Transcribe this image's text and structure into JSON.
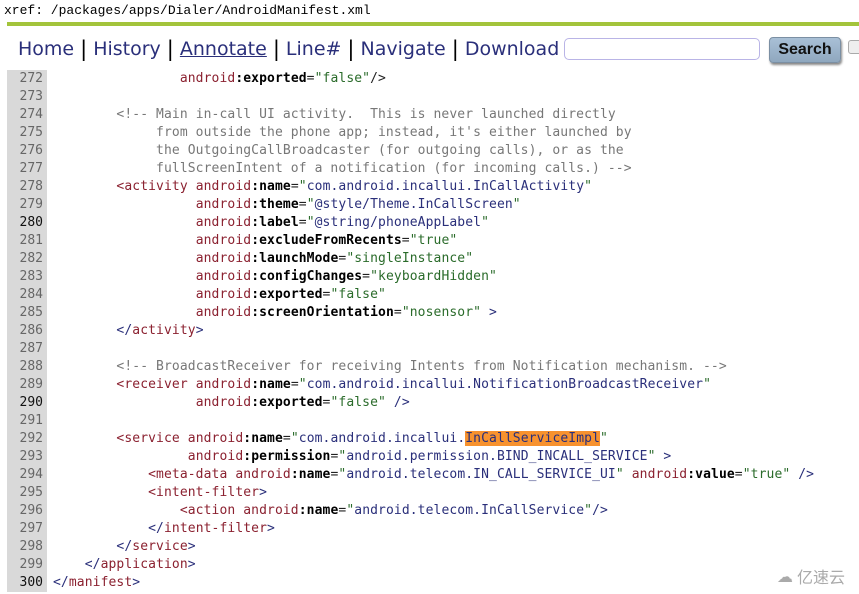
{
  "xref": "xref: /packages/apps/Dialer/AndroidManifest.xml",
  "nav": {
    "items": [
      {
        "label": "Home",
        "active": false
      },
      {
        "label": "History",
        "active": false
      },
      {
        "label": "Annotate",
        "active": true
      },
      {
        "label": "Line#",
        "active": false
      },
      {
        "label": "Navigate",
        "active": false
      },
      {
        "label": "Download",
        "active": false
      }
    ],
    "separator": "|"
  },
  "search": {
    "value": "",
    "placeholder": "",
    "button_label": "Search"
  },
  "colors": {
    "accent_bar": "#a3c43b",
    "highlight": "#f7922e",
    "link": "#2a2f7a"
  },
  "lines": [
    {
      "n": "272",
      "dark": false,
      "segments": [
        [
          "",
          "                "
        ],
        [
          "an",
          "android"
        ],
        [
          "at",
          ":exported"
        ],
        [
          "",
          "="
        ],
        [
          "v",
          "\"false\""
        ],
        [
          "",
          "/>"
        ]
      ]
    },
    {
      "n": "273",
      "dark": false,
      "segments": []
    },
    {
      "n": "274",
      "dark": false,
      "segments": [
        [
          "",
          "        "
        ],
        [
          "c",
          "<!-- Main in-call UI activity.  This is never launched directly"
        ]
      ]
    },
    {
      "n": "275",
      "dark": false,
      "segments": [
        [
          "",
          "             "
        ],
        [
          "c",
          "from outside the phone app; instead, it's either launched by"
        ]
      ]
    },
    {
      "n": "276",
      "dark": false,
      "segments": [
        [
          "",
          "             "
        ],
        [
          "c",
          "the OutgoingCallBroadcaster (for outgoing calls), or as the"
        ]
      ]
    },
    {
      "n": "277",
      "dark": false,
      "segments": [
        [
          "",
          "             "
        ],
        [
          "c",
          "fullScreenIntent of a notification (for incoming calls.) -->"
        ]
      ]
    },
    {
      "n": "278",
      "dark": false,
      "segments": [
        [
          "",
          "        "
        ],
        [
          "t",
          "<activity "
        ],
        [
          "an",
          "android"
        ],
        [
          "at",
          ":name"
        ],
        [
          "",
          "="
        ],
        [
          "v",
          "\""
        ],
        [
          "s",
          "com.android.incallui.InCallActivity"
        ],
        [
          "v",
          "\""
        ]
      ]
    },
    {
      "n": "279",
      "dark": false,
      "segments": [
        [
          "",
          "                  "
        ],
        [
          "an",
          "android"
        ],
        [
          "at",
          ":theme"
        ],
        [
          "",
          "="
        ],
        [
          "v",
          "\""
        ],
        [
          "s",
          "@style/Theme.InCallScreen"
        ],
        [
          "v",
          "\""
        ]
      ]
    },
    {
      "n": "280",
      "dark": true,
      "segments": [
        [
          "",
          "                  "
        ],
        [
          "an",
          "android"
        ],
        [
          "at",
          ":label"
        ],
        [
          "",
          "="
        ],
        [
          "v",
          "\""
        ],
        [
          "s",
          "@string/phoneAppLabel"
        ],
        [
          "v",
          "\""
        ]
      ]
    },
    {
      "n": "281",
      "dark": false,
      "segments": [
        [
          "",
          "                  "
        ],
        [
          "an",
          "android"
        ],
        [
          "at",
          ":excludeFromRecents"
        ],
        [
          "",
          "="
        ],
        [
          "v",
          "\"true\""
        ]
      ]
    },
    {
      "n": "282",
      "dark": false,
      "segments": [
        [
          "",
          "                  "
        ],
        [
          "an",
          "android"
        ],
        [
          "at",
          ":launchMode"
        ],
        [
          "",
          "="
        ],
        [
          "v",
          "\"singleInstance\""
        ]
      ]
    },
    {
      "n": "283",
      "dark": false,
      "segments": [
        [
          "",
          "                  "
        ],
        [
          "an",
          "android"
        ],
        [
          "at",
          ":configChanges"
        ],
        [
          "",
          "="
        ],
        [
          "v",
          "\"keyboardHidden\""
        ]
      ]
    },
    {
      "n": "284",
      "dark": false,
      "segments": [
        [
          "",
          "                  "
        ],
        [
          "an",
          "android"
        ],
        [
          "at",
          ":exported"
        ],
        [
          "",
          "="
        ],
        [
          "v",
          "\"false\""
        ]
      ]
    },
    {
      "n": "285",
      "dark": false,
      "segments": [
        [
          "",
          "                  "
        ],
        [
          "an",
          "android"
        ],
        [
          "at",
          ":screenOrientation"
        ],
        [
          "",
          "="
        ],
        [
          "v",
          "\"nosensor\""
        ],
        [
          "s",
          " >"
        ]
      ]
    },
    {
      "n": "286",
      "dark": false,
      "segments": [
        [
          "",
          "        "
        ],
        [
          "s",
          "</"
        ],
        [
          "t",
          "activity"
        ],
        [
          "s",
          ">"
        ]
      ]
    },
    {
      "n": "287",
      "dark": false,
      "segments": []
    },
    {
      "n": "288",
      "dark": false,
      "segments": [
        [
          "",
          "        "
        ],
        [
          "c",
          "<!-- BroadcastReceiver for receiving Intents from Notification mechanism. -->"
        ]
      ]
    },
    {
      "n": "289",
      "dark": false,
      "segments": [
        [
          "",
          "        "
        ],
        [
          "t",
          "<receiver "
        ],
        [
          "an",
          "android"
        ],
        [
          "at",
          ":name"
        ],
        [
          "",
          "="
        ],
        [
          "v",
          "\""
        ],
        [
          "s",
          "com.android.incallui.NotificationBroadcastReceiver"
        ],
        [
          "v",
          "\""
        ]
      ]
    },
    {
      "n": "290",
      "dark": true,
      "segments": [
        [
          "",
          "                  "
        ],
        [
          "an",
          "android"
        ],
        [
          "at",
          ":exported"
        ],
        [
          "",
          "="
        ],
        [
          "v",
          "\"false\""
        ],
        [
          "s",
          " />"
        ]
      ]
    },
    {
      "n": "291",
      "dark": false,
      "segments": []
    },
    {
      "n": "292",
      "dark": false,
      "segments": [
        [
          "",
          "        "
        ],
        [
          "t",
          "<service "
        ],
        [
          "an",
          "android"
        ],
        [
          "at",
          ":name"
        ],
        [
          "",
          "="
        ],
        [
          "v",
          "\""
        ],
        [
          "s",
          "com.android.incallui."
        ],
        [
          "hl",
          "InCallServiceImpl"
        ],
        [
          "v",
          "\""
        ]
      ]
    },
    {
      "n": "293",
      "dark": false,
      "segments": [
        [
          "",
          "                 "
        ],
        [
          "an",
          "android"
        ],
        [
          "at",
          ":permission"
        ],
        [
          "",
          "="
        ],
        [
          "v",
          "\""
        ],
        [
          "s",
          "android.permission.BIND_INCALL_SERVICE"
        ],
        [
          "v",
          "\""
        ],
        [
          "s",
          " >"
        ]
      ]
    },
    {
      "n": "294",
      "dark": false,
      "segments": [
        [
          "",
          "            "
        ],
        [
          "t",
          "<meta-data "
        ],
        [
          "an",
          "android"
        ],
        [
          "at",
          ":name"
        ],
        [
          "",
          "="
        ],
        [
          "v",
          "\""
        ],
        [
          "s",
          "android.telecom.IN_CALL_SERVICE_UI"
        ],
        [
          "v",
          "\""
        ],
        [
          "s",
          " "
        ],
        [
          "an",
          "android"
        ],
        [
          "at",
          ":value"
        ],
        [
          "",
          "="
        ],
        [
          "v",
          "\"true\""
        ],
        [
          "s",
          " />"
        ]
      ]
    },
    {
      "n": "295",
      "dark": false,
      "segments": [
        [
          "",
          "            "
        ],
        [
          "t",
          "<intent-filter"
        ],
        [
          "s",
          ">"
        ]
      ]
    },
    {
      "n": "296",
      "dark": false,
      "segments": [
        [
          "",
          "                "
        ],
        [
          "t",
          "<action "
        ],
        [
          "an",
          "android"
        ],
        [
          "at",
          ":name"
        ],
        [
          "",
          "="
        ],
        [
          "v",
          "\""
        ],
        [
          "s",
          "android.telecom.InCallService"
        ],
        [
          "v",
          "\""
        ],
        [
          "s",
          "/>"
        ]
      ]
    },
    {
      "n": "297",
      "dark": false,
      "segments": [
        [
          "",
          "            "
        ],
        [
          "s",
          "</"
        ],
        [
          "t",
          "intent-filter"
        ],
        [
          "s",
          ">"
        ]
      ]
    },
    {
      "n": "298",
      "dark": false,
      "segments": [
        [
          "",
          "        "
        ],
        [
          "s",
          "</"
        ],
        [
          "t",
          "service"
        ],
        [
          "s",
          ">"
        ]
      ]
    },
    {
      "n": "299",
      "dark": false,
      "segments": [
        [
          "",
          "    "
        ],
        [
          "s",
          "</"
        ],
        [
          "t",
          "application"
        ],
        [
          "s",
          ">"
        ]
      ]
    },
    {
      "n": "300",
      "dark": true,
      "segments": [
        [
          "s",
          "</"
        ],
        [
          "t",
          "manifest"
        ],
        [
          "s",
          ">"
        ]
      ]
    }
  ],
  "watermark": "亿速云"
}
